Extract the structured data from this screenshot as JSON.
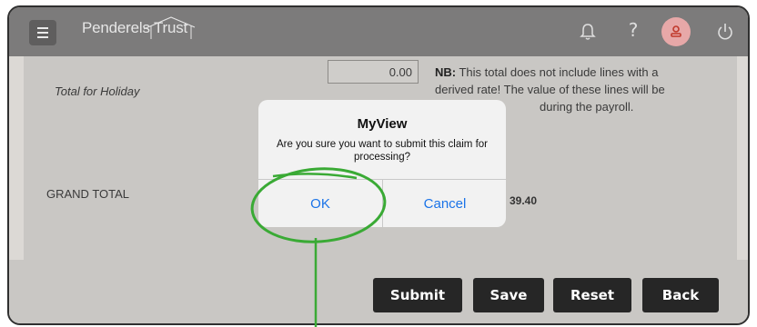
{
  "header": {
    "logo_text": "Penderels Trust",
    "menu_icon": "hamburger-icon",
    "icons": [
      "bell-icon",
      "help-icon",
      "user-avatar-icon",
      "power-icon"
    ],
    "help_glyph": "?"
  },
  "claim": {
    "holiday_label": "Total for Holiday",
    "holiday_value": "0.00",
    "note_bold": "NB:",
    "note_text": " This total does not include lines with a derived rate! The value of these lines will be",
    "note_tail": "during the payroll.",
    "grand_total_label": "GRAND TOTAL",
    "grand_total_value_partial": "39.40"
  },
  "dialog": {
    "title": "MyView",
    "message": "Are you sure you want to submit this claim for processing?",
    "ok_label": "OK",
    "cancel_label": "Cancel"
  },
  "buttons": {
    "submit": "Submit",
    "save": "Save",
    "reset": "Reset",
    "back": "Back"
  },
  "colors": {
    "topbar": "#7c7b7b",
    "button_bg": "#262626",
    "dialog_link": "#1a73e8",
    "annotation_green": "#3aaa35"
  }
}
